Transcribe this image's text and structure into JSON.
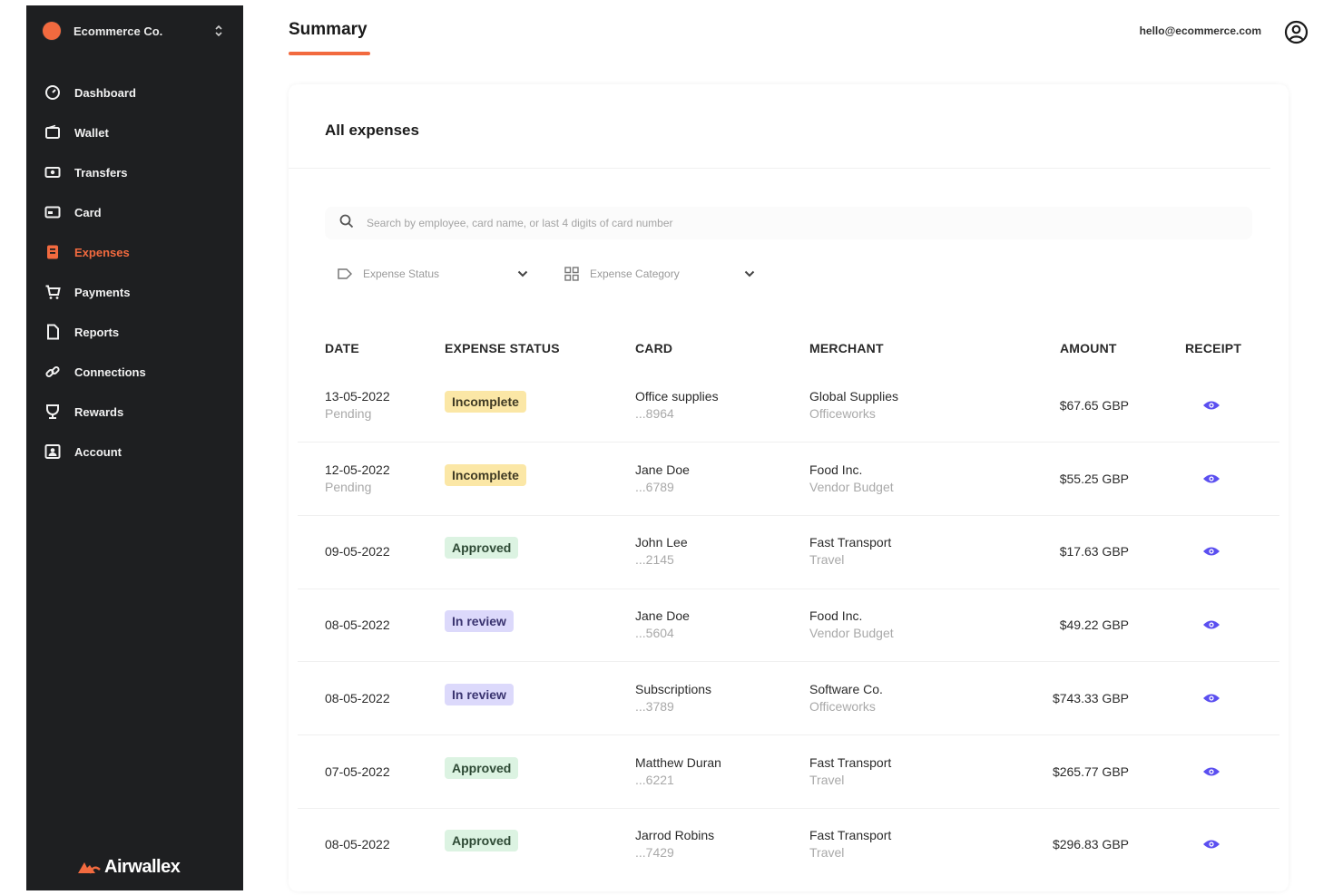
{
  "sidebar": {
    "org_name": "Ecommerce Co.",
    "items": [
      {
        "label": "Dashboard",
        "icon": "dashboard-icon"
      },
      {
        "label": "Wallet",
        "icon": "wallet-icon"
      },
      {
        "label": "Transfers",
        "icon": "transfers-icon"
      },
      {
        "label": "Card",
        "icon": "card-icon"
      },
      {
        "label": "Expenses",
        "icon": "expenses-icon",
        "active": true
      },
      {
        "label": "Payments",
        "icon": "cart-icon"
      },
      {
        "label": "Reports",
        "icon": "report-icon"
      },
      {
        "label": "Connections",
        "icon": "link-icon"
      },
      {
        "label": "Rewards",
        "icon": "trophy-icon"
      },
      {
        "label": "Account",
        "icon": "account-icon"
      }
    ],
    "brand": "Airwallex"
  },
  "header": {
    "title": "Summary",
    "user_email": "hello@ecommerce.com"
  },
  "expenses": {
    "title": "All expenses",
    "search_placeholder": "Search by employee, card name, or last 4 digits of card number",
    "filters": {
      "status_label": "Expense Status",
      "category_label": "Expense Category"
    },
    "columns": {
      "date": "DATE",
      "status": "EXPENSE STATUS",
      "card": "CARD",
      "merchant": "MERCHANT",
      "amount": "AMOUNT",
      "receipt": "RECEIPT"
    },
    "rows": [
      {
        "date": "13-05-2022",
        "date_sub": "Pending",
        "status": "Incomplete",
        "card": "Office supplies",
        "card_sub": "...8964",
        "merchant": "Global Supplies",
        "merchant_sub": "Officeworks",
        "amount": "$67.65 GBP"
      },
      {
        "date": "12-05-2022",
        "date_sub": "Pending",
        "status": "Incomplete",
        "card": "Jane Doe",
        "card_sub": "...6789",
        "merchant": "Food Inc.",
        "merchant_sub": "Vendor Budget",
        "amount": "$55.25 GBP"
      },
      {
        "date": "09-05-2022",
        "date_sub": "",
        "status": "Approved",
        "card": "John Lee",
        "card_sub": "...2145",
        "merchant": "Fast Transport",
        "merchant_sub": "Travel",
        "amount": "$17.63 GBP"
      },
      {
        "date": "08-05-2022",
        "date_sub": "",
        "status": "In review",
        "card": "Jane Doe",
        "card_sub": "...5604",
        "merchant": "Food Inc.",
        "merchant_sub": "Vendor Budget",
        "amount": "$49.22 GBP"
      },
      {
        "date": "08-05-2022",
        "date_sub": "",
        "status": "In review",
        "card": "Subscriptions",
        "card_sub": "...3789",
        "merchant": "Software Co.",
        "merchant_sub": "Officeworks",
        "amount": "$743.33 GBP"
      },
      {
        "date": "07-05-2022",
        "date_sub": "",
        "status": "Approved",
        "card": "Matthew Duran",
        "card_sub": "...6221",
        "merchant": "Fast Transport",
        "merchant_sub": "Travel",
        "amount": "$265.77 GBP"
      },
      {
        "date": "08-05-2022",
        "date_sub": "",
        "status": "Approved",
        "card": "Jarrod Robins",
        "card_sub": "...7429",
        "merchant": "Fast Transport",
        "merchant_sub": "Travel",
        "amount": "$296.83 GBP"
      }
    ]
  },
  "colors": {
    "accent": "#f26a3f",
    "sidebar_bg": "#1e1f21",
    "incomplete_bg": "#fbe7a6",
    "approved_bg": "#dcf3e2",
    "review_bg": "#dcd9fb",
    "eye": "#5b4ff0"
  }
}
